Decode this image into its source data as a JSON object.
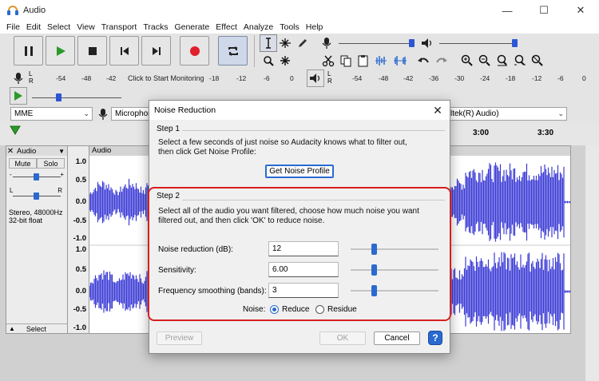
{
  "window": {
    "title": "Audio",
    "min": "—",
    "max": "☐",
    "close": "✕"
  },
  "menu": [
    "File",
    "Edit",
    "Select",
    "View",
    "Transport",
    "Tracks",
    "Generate",
    "Effect",
    "Analyze",
    "Tools",
    "Help"
  ],
  "meters": {
    "record_ticks": [
      "-54",
      "-48",
      "-42",
      "-18",
      "-12",
      "-6",
      "0"
    ],
    "record_prompt": "Click to Start Monitoring",
    "play_ticks": [
      "-54",
      "-48",
      "-42",
      "-36",
      "-30",
      "-24",
      "-18",
      "-12",
      "-6",
      "0"
    ],
    "lr_l": "L",
    "lr_r": "R"
  },
  "devices": {
    "host": "MME",
    "mic": "Microphon",
    "output": "ltek(R) Audio)"
  },
  "timeline": {
    "t1": "3:00",
    "t2": "3:30"
  },
  "track": {
    "name": "Audio",
    "mute": "Mute",
    "solo": "Solo",
    "l": "L",
    "r": "R",
    "format_line1": "Stereo, 48000Hz",
    "format_line2": "32-bit float",
    "select": "Select",
    "clip_name": "Audio",
    "scale": [
      "1.0",
      "0.5",
      "0.0",
      "-0.5",
      "-1.0",
      "1.0",
      "0.5",
      "0.0",
      "-0.5",
      "-1.0"
    ]
  },
  "dialog": {
    "title": "Noise Reduction",
    "close": "✕",
    "step1": {
      "label": "Step 1",
      "text1": "Select a few seconds of just noise so Audacity knows what to filter out,",
      "text2": "then click Get Noise Profile:",
      "button": "Get Noise Profile"
    },
    "step2": {
      "label": "Step 2",
      "text1": "Select all of the audio you want filtered, choose how much noise you want",
      "text2": "filtered out, and then click 'OK' to reduce noise.",
      "fields": [
        {
          "label": "Noise reduction (dB):",
          "value": "12"
        },
        {
          "label": "Sensitivity:",
          "value": "6.00"
        },
        {
          "label": "Frequency smoothing (bands):",
          "value": "3"
        }
      ],
      "noise_label": "Noise:",
      "reduce": "Reduce",
      "residue": "Residue"
    },
    "buttons": {
      "preview": "Preview",
      "ok": "OK",
      "cancel": "Cancel",
      "help": "?"
    }
  },
  "colors": {
    "accent": "#2a6ad0",
    "highlight": "#d81e1e",
    "waveform": "#3b3bd6"
  }
}
